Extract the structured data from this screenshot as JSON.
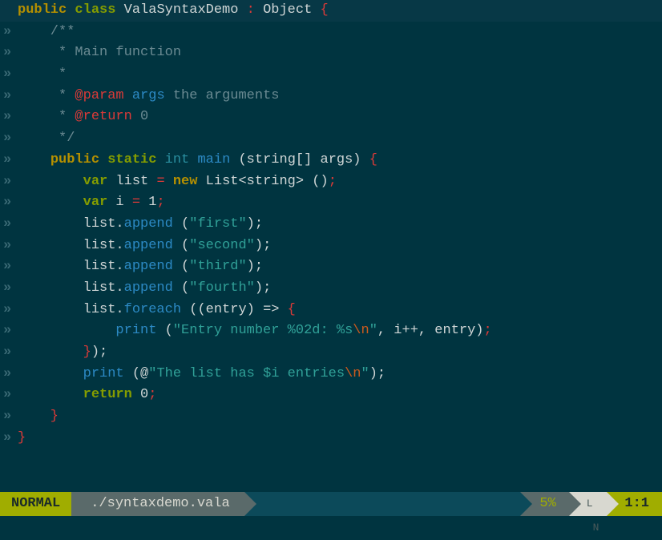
{
  "statusbar": {
    "mode": "NORMAL",
    "filename": "./syntaxdemo.vala",
    "percent": "5%",
    "ln_label": "LN",
    "position": "1:1"
  },
  "gutter_marker": "»",
  "code": {
    "l1": {
      "public": "public",
      "class": "class",
      "name": "ValaSyntaxDemo",
      "colon": " :",
      "object": "Object",
      "brace": " {"
    },
    "l2": "    /**",
    "l3": "     * Main function",
    "l4": "     *",
    "l5": {
      "pre": "     * ",
      "tag": "@param",
      "sp": " ",
      "args": "args",
      "rest": " the arguments"
    },
    "l6": {
      "pre": "     * ",
      "tag": "@return",
      "rest": " 0"
    },
    "l7": "     */",
    "l8": {
      "ind": "    ",
      "public": "public",
      "static": "static",
      "int": "int",
      "main": "main",
      "sig": " (string[] args) ",
      "brace": "{"
    },
    "l9": {
      "ind": "        ",
      "var": "var",
      "name": " list ",
      "eq": "= ",
      "new": "new",
      "type": " List<string> ()",
      "semi": ";"
    },
    "l10": {
      "ind": "        ",
      "var": "var",
      "name": " i ",
      "eq": "= ",
      "num": "1",
      "semi": ";"
    },
    "l11": {
      "ind": "        list.",
      "method": "append",
      "paren": " (",
      "str": "\"first\"",
      "end": ");"
    },
    "l12": {
      "ind": "        list.",
      "method": "append",
      "paren": " (",
      "str": "\"second\"",
      "end": ");"
    },
    "l13": {
      "ind": "        list.",
      "method": "append",
      "paren": " (",
      "str": "\"third\"",
      "end": ");"
    },
    "l14": {
      "ind": "        list.",
      "method": "append",
      "paren": " (",
      "str": "\"fourth\"",
      "end": ");"
    },
    "l15": {
      "ind": "        list.",
      "method": "foreach",
      "rest": " ((entry) => ",
      "brace": "{"
    },
    "l16": {
      "ind": "            ",
      "print": "print",
      "paren": " (",
      "str1": "\"Entry number %02d: %s",
      "esc": "\\n",
      "str2": "\"",
      "args": ", i++, entry)",
      "semi": ";"
    },
    "l17": {
      "ind": "        ",
      "close": "}",
      "end": ");"
    },
    "l18": {
      "ind": "        ",
      "print": "print",
      "paren": " (@",
      "str1": "\"The list has $i entries",
      "esc": "\\n",
      "str2": "\"",
      "end": ");"
    },
    "l19": {
      "ind": "        ",
      "return": "return",
      "sp": " ",
      "num": "0",
      "semi": ";"
    },
    "l20": "    }",
    "l21": "}"
  }
}
